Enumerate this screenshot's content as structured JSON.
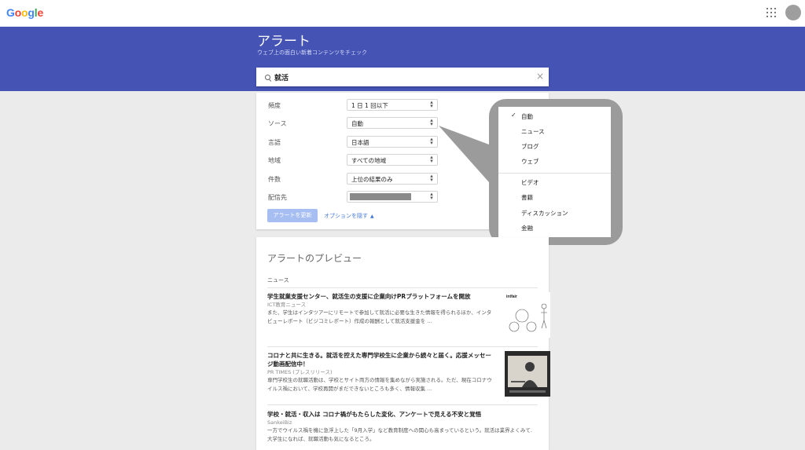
{
  "header": {
    "logo_letters": [
      {
        "ch": "G",
        "color": "#4285f4"
      },
      {
        "ch": "o",
        "color": "#ea4335"
      },
      {
        "ch": "o",
        "color": "#fbbc05"
      },
      {
        "ch": "g",
        "color": "#4285f4"
      },
      {
        "ch": "l",
        "color": "#34a853"
      },
      {
        "ch": "e",
        "color": "#ea4335"
      }
    ],
    "apps_icon": "apps-grid-icon",
    "avatar_icon": "account-avatar"
  },
  "banner": {
    "title": "アラート",
    "subtitle": "ウェブ上の面白い新着コンテンツをチェック",
    "color": "#4453b4"
  },
  "search": {
    "value": "就活",
    "icon": "search-icon",
    "clear": "×"
  },
  "options": [
    {
      "label": "頻度",
      "value": "1 日 1 回以下"
    },
    {
      "label": "ソース",
      "value": "自動"
    },
    {
      "label": "言語",
      "value": "日本語"
    },
    {
      "label": "地域",
      "value": "すべての地域"
    },
    {
      "label": "件数",
      "value": "上位の結果のみ"
    },
    {
      "label": "配信先",
      "value": ""
    }
  ],
  "actions": {
    "update_label": "アラートを更新",
    "fewer_options_label": "オプションを隠す"
  },
  "source_dropdown": {
    "checked": "✓",
    "items": [
      "自動",
      "ニュース",
      "ブログ",
      "ウェブ",
      "ビデオ",
      "書籍",
      "ディスカッション",
      "金融"
    ]
  },
  "preview": {
    "title": "アラートのプレビュー",
    "section": "ニュース",
    "results": [
      {
        "title": "学生就業支援センター、就活生の支援に企業向けPRプラットフォームを開放",
        "source": "ICT教育ニュース",
        "snippet": "また、学生はインタツアーにリモートで参加して就活に必要な生きた情報を得られるほか、インタビューレポート（ビジコミレポート）作成の報酬として就活支援金を ..."
      },
      {
        "title": "コロナと共に生きる。就活を控えた専門学校生に企業から続々と届く。応援メッセージ動画配信中！",
        "source": "PR TIMES (プレスリリース)",
        "snippet": "専門学校生の就職活動は、学校とサイト両方の情報を集めながら実施される。ただ、現在コロナウイルス禍において、学校再開がまだできないところも多く、情報収集 ..."
      },
      {
        "title": "学校・就活・収入は コロナ禍がもたらした変化、アンケートで見える不安と覚悟",
        "source": "SankeiBiz",
        "snippet": "一方でウイルス禍を機に急浮上した「9月入学」など教育制度への関心も高まっているという。就活は業界よくみて. 大学生になれば、就職活動も気になるところ。"
      }
    ],
    "thumb1_text": "intfair"
  }
}
